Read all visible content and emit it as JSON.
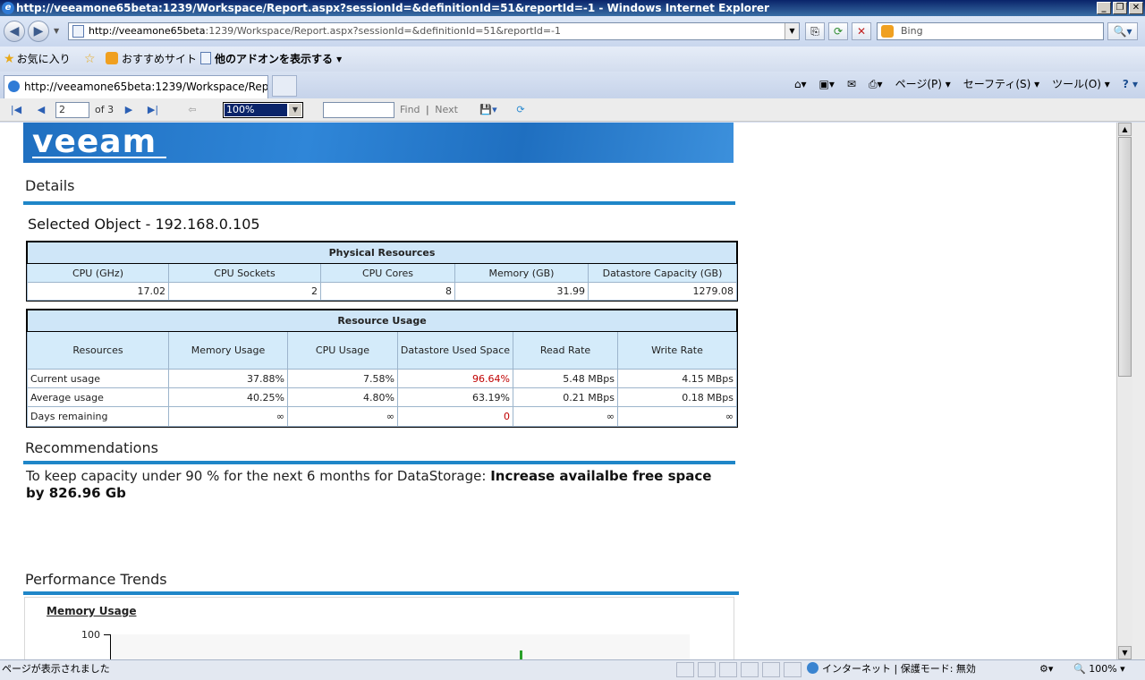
{
  "window": {
    "title": "http://veeamone65beta:1239/Workspace/Report.aspx?sessionId=&definitionId=51&reportId=-1 - Windows Internet Explorer",
    "minimize": "_",
    "restore": "❐",
    "close": "✕"
  },
  "address": {
    "url_host": "http://veeamone65beta",
    "url_rest": ":1239/Workspace/Report.aspx?sessionId=&definitionId=51&reportId=-1",
    "search_placeholder": "Bing"
  },
  "favorites": {
    "favorites_label": "お気に入り",
    "suggested_sites": "おすすめサイト ▾",
    "more_addons": "他のアドオンを表示する ▾"
  },
  "tabs": {
    "active_tab": "http://veeamone65beta:1239/Workspace/Report.as..."
  },
  "commandbar": {
    "page": "ページ(P) ▾",
    "safety": "セーフティ(S) ▾",
    "tools": "ツール(O) ▾",
    "help": "? ▾"
  },
  "report_toolbar": {
    "current_page": "2",
    "of_pages": "of 3",
    "zoom": "100%",
    "find": "Find",
    "separator": "|",
    "next": "Next"
  },
  "report": {
    "logo": "veeam",
    "details_title": "Details",
    "selected_object": "Selected Object - 192.168.0.105",
    "physical": {
      "title": "Physical Resources",
      "columns": [
        "CPU (GHz)",
        "CPU Sockets",
        "CPU Cores",
        "Memory (GB)",
        "Datastore Capacity (GB)"
      ],
      "values": [
        "17.02",
        "2",
        "8",
        "31.99",
        "1279.08"
      ]
    },
    "usage": {
      "title": "Resource Usage",
      "columns": [
        "Resources",
        "Memory Usage",
        "CPU Usage",
        "Datastore Used Space",
        "Read Rate",
        "Write Rate"
      ],
      "rows": [
        [
          "Current usage",
          "37.88%",
          "7.58%",
          "96.64%",
          "5.48 MBps",
          "4.15 MBps"
        ],
        [
          "Average usage",
          "40.25%",
          "4.80%",
          "63.19%",
          "0.21 MBps",
          "0.18 MBps"
        ],
        [
          "Days remaining",
          "∞",
          "∞",
          "0",
          "∞",
          "∞"
        ]
      ],
      "alert_color": "#c00000"
    },
    "recommendations_title": "Recommendations",
    "recommendation_prefix": "To keep capacity under 90 % for the next 6 months for DataStorage:",
    "recommendation_action": "Increase availalbe free space by 826.96 Gb",
    "trends_title": "Performance Trends",
    "chart_title": "Memory Usage",
    "chart_y_top": "100",
    "accent_color": "#1f86c8"
  },
  "statusbar": {
    "message": "ページが表示されました",
    "zone": "インターネット | 保護モード: 無効",
    "zoom": "100%"
  }
}
